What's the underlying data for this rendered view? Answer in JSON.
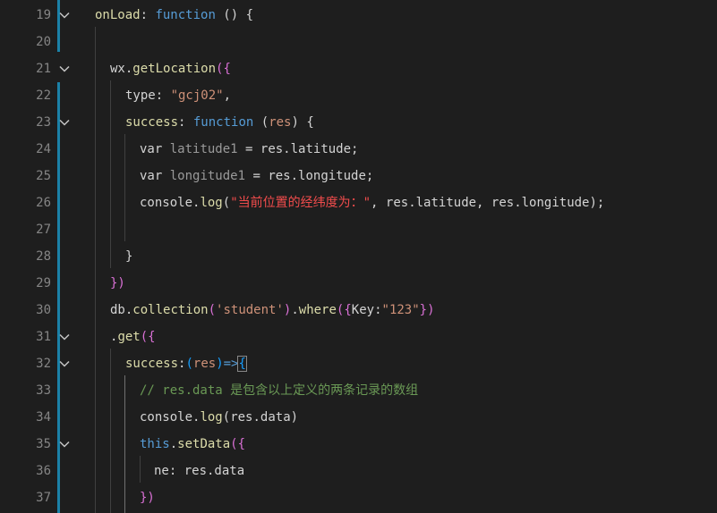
{
  "editor": {
    "line_numbers": [
      "19",
      "20",
      "21",
      "22",
      "23",
      "24",
      "25",
      "26",
      "27",
      "28",
      "29",
      "30",
      "31",
      "32",
      "33",
      "34",
      "35",
      "36",
      "37"
    ],
    "code": {
      "l19": {
        "key": "onLoad",
        "colon": ": ",
        "kw": "function",
        "rest": " () {"
      },
      "l21": {
        "obj": "wx",
        "dot": ".",
        "fn": "getLocation",
        "open": "({"
      },
      "l22": {
        "prop": "type",
        "colon": ": ",
        "str": "\"gcj02\"",
        "comma": ","
      },
      "l23": {
        "prop": "success",
        "colon": ": ",
        "kw": "function",
        "sp": " ",
        "paren_open": "(",
        "param": "res",
        "paren_close": ")",
        "brace": " {"
      },
      "l24": {
        "kw": "var",
        "var": " latitude1",
        "eq": " = ",
        "rhs": "res.latitude;"
      },
      "l25": {
        "kw": "var",
        "var": " longitude1",
        "eq": " = ",
        "rhs": "res.longitude;"
      },
      "l26": {
        "obj": "console",
        "dot": ".",
        "fn": "log",
        "open": "(",
        "str": "\"当前位置的经纬度为：\"",
        "args": ", res.latitude, res.longitude",
        "close": ");"
      },
      "l28": {
        "brace": "}"
      },
      "l29": {
        "close": "})"
      },
      "l30": {
        "obj": "db",
        "dot": ".",
        "fn": "collection",
        "open": "(",
        "str": "'student'",
        "close": ")",
        "dot2": ".",
        "fn2": "where",
        "open2": "({",
        "key": "Key",
        "colon": ":",
        "str2": "\"123\"",
        "close2": "})"
      },
      "l31": {
        "dot": ".",
        "fn": "get",
        "open": "({"
      },
      "l32": {
        "prop": "success",
        "colon": ":",
        "paren_open": "(",
        "param": "res",
        "paren_close": ")",
        "arrow": "=>",
        "brace": "{"
      },
      "l33": {
        "comment": "// res.data 是包含以上定义的两条记录的数组"
      },
      "l34": {
        "obj": "console",
        "dot": ".",
        "fn": "log",
        "open": "(",
        "args": "res.data",
        "close": ")"
      },
      "l35": {
        "kw": "this",
        "dot": ".",
        "fn": "setData",
        "open": "({"
      },
      "l36": {
        "prop": "ne",
        "colon": ": ",
        "rhs": "res.data"
      },
      "l37": {
        "close": "})"
      }
    },
    "colors": {
      "background": "#1e1e1e",
      "line_number": "#858585",
      "keyword": "#569cd6",
      "function": "#dcdcaa",
      "variable": "#9cdcfe",
      "string": "#ce9178",
      "comment": "#6a9955",
      "git_modified_bar": "#1b81a8"
    },
    "icons": [
      "chevron-down-icon"
    ]
  }
}
